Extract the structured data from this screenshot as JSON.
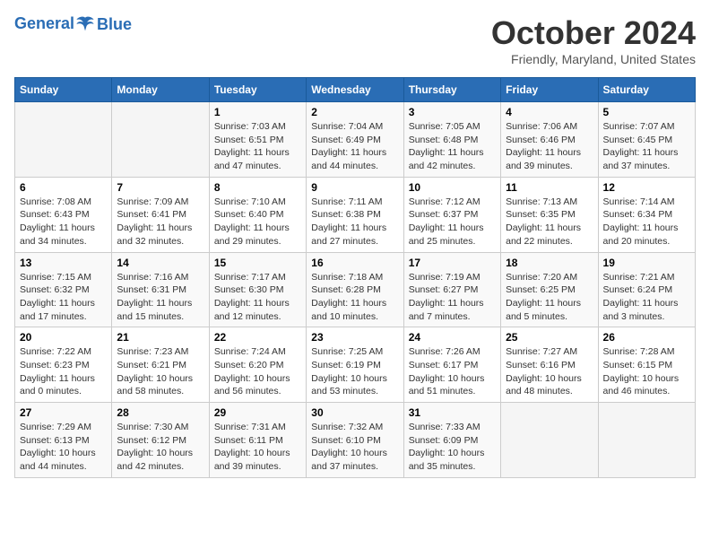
{
  "logo": {
    "line1": "General",
    "line2": "Blue"
  },
  "title": "October 2024",
  "subtitle": "Friendly, Maryland, United States",
  "header_days": [
    "Sunday",
    "Monday",
    "Tuesday",
    "Wednesday",
    "Thursday",
    "Friday",
    "Saturday"
  ],
  "weeks": [
    [
      {
        "num": "",
        "sunrise": "",
        "sunset": "",
        "daylight": ""
      },
      {
        "num": "",
        "sunrise": "",
        "sunset": "",
        "daylight": ""
      },
      {
        "num": "1",
        "sunrise": "Sunrise: 7:03 AM",
        "sunset": "Sunset: 6:51 PM",
        "daylight": "Daylight: 11 hours and 47 minutes."
      },
      {
        "num": "2",
        "sunrise": "Sunrise: 7:04 AM",
        "sunset": "Sunset: 6:49 PM",
        "daylight": "Daylight: 11 hours and 44 minutes."
      },
      {
        "num": "3",
        "sunrise": "Sunrise: 7:05 AM",
        "sunset": "Sunset: 6:48 PM",
        "daylight": "Daylight: 11 hours and 42 minutes."
      },
      {
        "num": "4",
        "sunrise": "Sunrise: 7:06 AM",
        "sunset": "Sunset: 6:46 PM",
        "daylight": "Daylight: 11 hours and 39 minutes."
      },
      {
        "num": "5",
        "sunrise": "Sunrise: 7:07 AM",
        "sunset": "Sunset: 6:45 PM",
        "daylight": "Daylight: 11 hours and 37 minutes."
      }
    ],
    [
      {
        "num": "6",
        "sunrise": "Sunrise: 7:08 AM",
        "sunset": "Sunset: 6:43 PM",
        "daylight": "Daylight: 11 hours and 34 minutes."
      },
      {
        "num": "7",
        "sunrise": "Sunrise: 7:09 AM",
        "sunset": "Sunset: 6:41 PM",
        "daylight": "Daylight: 11 hours and 32 minutes."
      },
      {
        "num": "8",
        "sunrise": "Sunrise: 7:10 AM",
        "sunset": "Sunset: 6:40 PM",
        "daylight": "Daylight: 11 hours and 29 minutes."
      },
      {
        "num": "9",
        "sunrise": "Sunrise: 7:11 AM",
        "sunset": "Sunset: 6:38 PM",
        "daylight": "Daylight: 11 hours and 27 minutes."
      },
      {
        "num": "10",
        "sunrise": "Sunrise: 7:12 AM",
        "sunset": "Sunset: 6:37 PM",
        "daylight": "Daylight: 11 hours and 25 minutes."
      },
      {
        "num": "11",
        "sunrise": "Sunrise: 7:13 AM",
        "sunset": "Sunset: 6:35 PM",
        "daylight": "Daylight: 11 hours and 22 minutes."
      },
      {
        "num": "12",
        "sunrise": "Sunrise: 7:14 AM",
        "sunset": "Sunset: 6:34 PM",
        "daylight": "Daylight: 11 hours and 20 minutes."
      }
    ],
    [
      {
        "num": "13",
        "sunrise": "Sunrise: 7:15 AM",
        "sunset": "Sunset: 6:32 PM",
        "daylight": "Daylight: 11 hours and 17 minutes."
      },
      {
        "num": "14",
        "sunrise": "Sunrise: 7:16 AM",
        "sunset": "Sunset: 6:31 PM",
        "daylight": "Daylight: 11 hours and 15 minutes."
      },
      {
        "num": "15",
        "sunrise": "Sunrise: 7:17 AM",
        "sunset": "Sunset: 6:30 PM",
        "daylight": "Daylight: 11 hours and 12 minutes."
      },
      {
        "num": "16",
        "sunrise": "Sunrise: 7:18 AM",
        "sunset": "Sunset: 6:28 PM",
        "daylight": "Daylight: 11 hours and 10 minutes."
      },
      {
        "num": "17",
        "sunrise": "Sunrise: 7:19 AM",
        "sunset": "Sunset: 6:27 PM",
        "daylight": "Daylight: 11 hours and 7 minutes."
      },
      {
        "num": "18",
        "sunrise": "Sunrise: 7:20 AM",
        "sunset": "Sunset: 6:25 PM",
        "daylight": "Daylight: 11 hours and 5 minutes."
      },
      {
        "num": "19",
        "sunrise": "Sunrise: 7:21 AM",
        "sunset": "Sunset: 6:24 PM",
        "daylight": "Daylight: 11 hours and 3 minutes."
      }
    ],
    [
      {
        "num": "20",
        "sunrise": "Sunrise: 7:22 AM",
        "sunset": "Sunset: 6:23 PM",
        "daylight": "Daylight: 11 hours and 0 minutes."
      },
      {
        "num": "21",
        "sunrise": "Sunrise: 7:23 AM",
        "sunset": "Sunset: 6:21 PM",
        "daylight": "Daylight: 10 hours and 58 minutes."
      },
      {
        "num": "22",
        "sunrise": "Sunrise: 7:24 AM",
        "sunset": "Sunset: 6:20 PM",
        "daylight": "Daylight: 10 hours and 56 minutes."
      },
      {
        "num": "23",
        "sunrise": "Sunrise: 7:25 AM",
        "sunset": "Sunset: 6:19 PM",
        "daylight": "Daylight: 10 hours and 53 minutes."
      },
      {
        "num": "24",
        "sunrise": "Sunrise: 7:26 AM",
        "sunset": "Sunset: 6:17 PM",
        "daylight": "Daylight: 10 hours and 51 minutes."
      },
      {
        "num": "25",
        "sunrise": "Sunrise: 7:27 AM",
        "sunset": "Sunset: 6:16 PM",
        "daylight": "Daylight: 10 hours and 48 minutes."
      },
      {
        "num": "26",
        "sunrise": "Sunrise: 7:28 AM",
        "sunset": "Sunset: 6:15 PM",
        "daylight": "Daylight: 10 hours and 46 minutes."
      }
    ],
    [
      {
        "num": "27",
        "sunrise": "Sunrise: 7:29 AM",
        "sunset": "Sunset: 6:13 PM",
        "daylight": "Daylight: 10 hours and 44 minutes."
      },
      {
        "num": "28",
        "sunrise": "Sunrise: 7:30 AM",
        "sunset": "Sunset: 6:12 PM",
        "daylight": "Daylight: 10 hours and 42 minutes."
      },
      {
        "num": "29",
        "sunrise": "Sunrise: 7:31 AM",
        "sunset": "Sunset: 6:11 PM",
        "daylight": "Daylight: 10 hours and 39 minutes."
      },
      {
        "num": "30",
        "sunrise": "Sunrise: 7:32 AM",
        "sunset": "Sunset: 6:10 PM",
        "daylight": "Daylight: 10 hours and 37 minutes."
      },
      {
        "num": "31",
        "sunrise": "Sunrise: 7:33 AM",
        "sunset": "Sunset: 6:09 PM",
        "daylight": "Daylight: 10 hours and 35 minutes."
      },
      {
        "num": "",
        "sunrise": "",
        "sunset": "",
        "daylight": ""
      },
      {
        "num": "",
        "sunrise": "",
        "sunset": "",
        "daylight": ""
      }
    ]
  ]
}
